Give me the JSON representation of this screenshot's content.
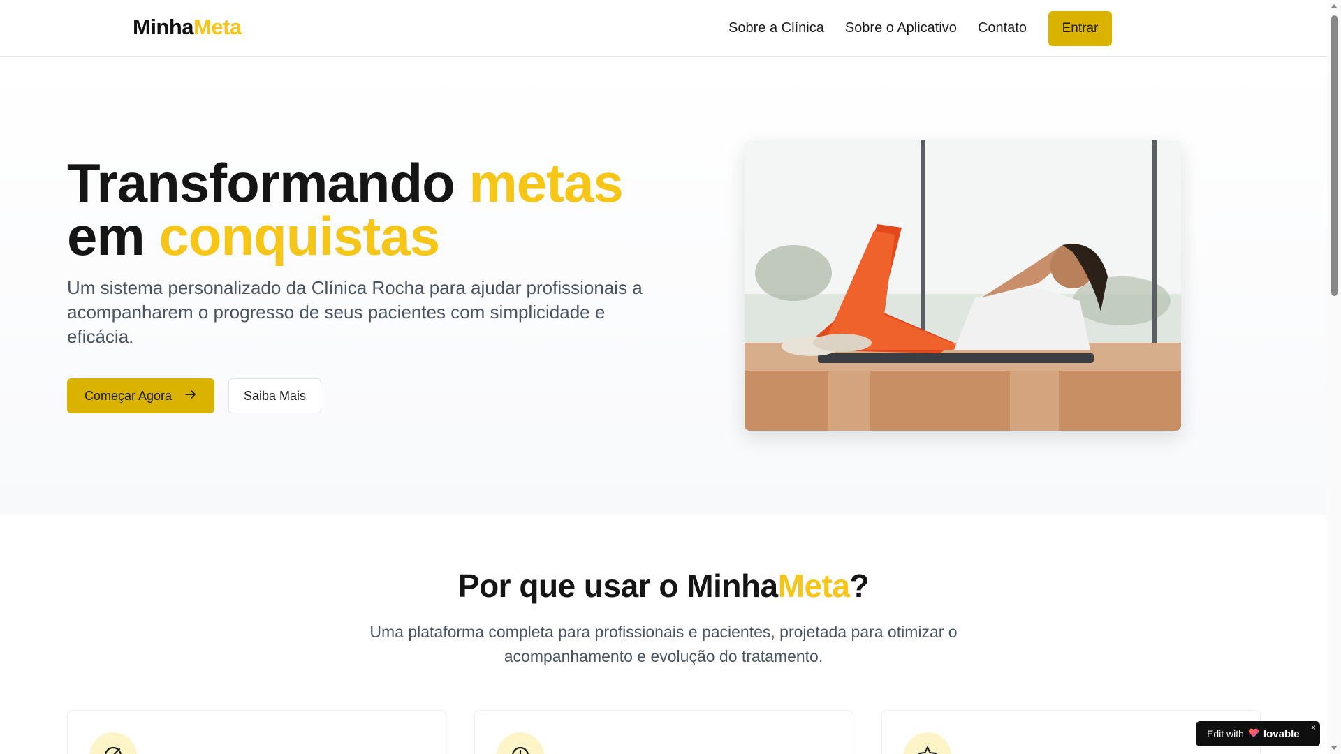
{
  "navbar": {
    "logo_main": "Minha",
    "logo_accent": "Meta",
    "links": [
      {
        "label": "Sobre a Clínica"
      },
      {
        "label": "Sobre o Aplicativo"
      },
      {
        "label": "Contato"
      }
    ],
    "login_label": "Entrar"
  },
  "hero": {
    "title_part1": "Transformando ",
    "title_accent1": "metas",
    "title_part2": "em ",
    "title_accent2": "conquistas",
    "description": "Um sistema personalizado da Clínica Rocha para ajudar profissionais a acompanharem o progresso de seus pacientes com simplicidade e eficácia.",
    "primary_button": "Começar Agora",
    "secondary_button": "Saiba Mais",
    "image_subject": "woman-doing-crunches-on-mat"
  },
  "features": {
    "title_prefix": "Por que usar o ",
    "title_main": "Minha",
    "title_accent": "Meta",
    "title_suffix": "?",
    "description": "Uma plataforma completa para profissionais e pacientes, projetada para otimizar o acompanhamento e evolução do tratamento.",
    "card_icons": [
      "target-icon",
      "clock-icon",
      "star-icon"
    ]
  },
  "badge": {
    "prefix": "Edit with",
    "brand": "lovable",
    "close": "×"
  },
  "colors": {
    "accent": "#f5c518",
    "button": "#d9b300",
    "text": "#151515",
    "muted": "#4a5361"
  }
}
